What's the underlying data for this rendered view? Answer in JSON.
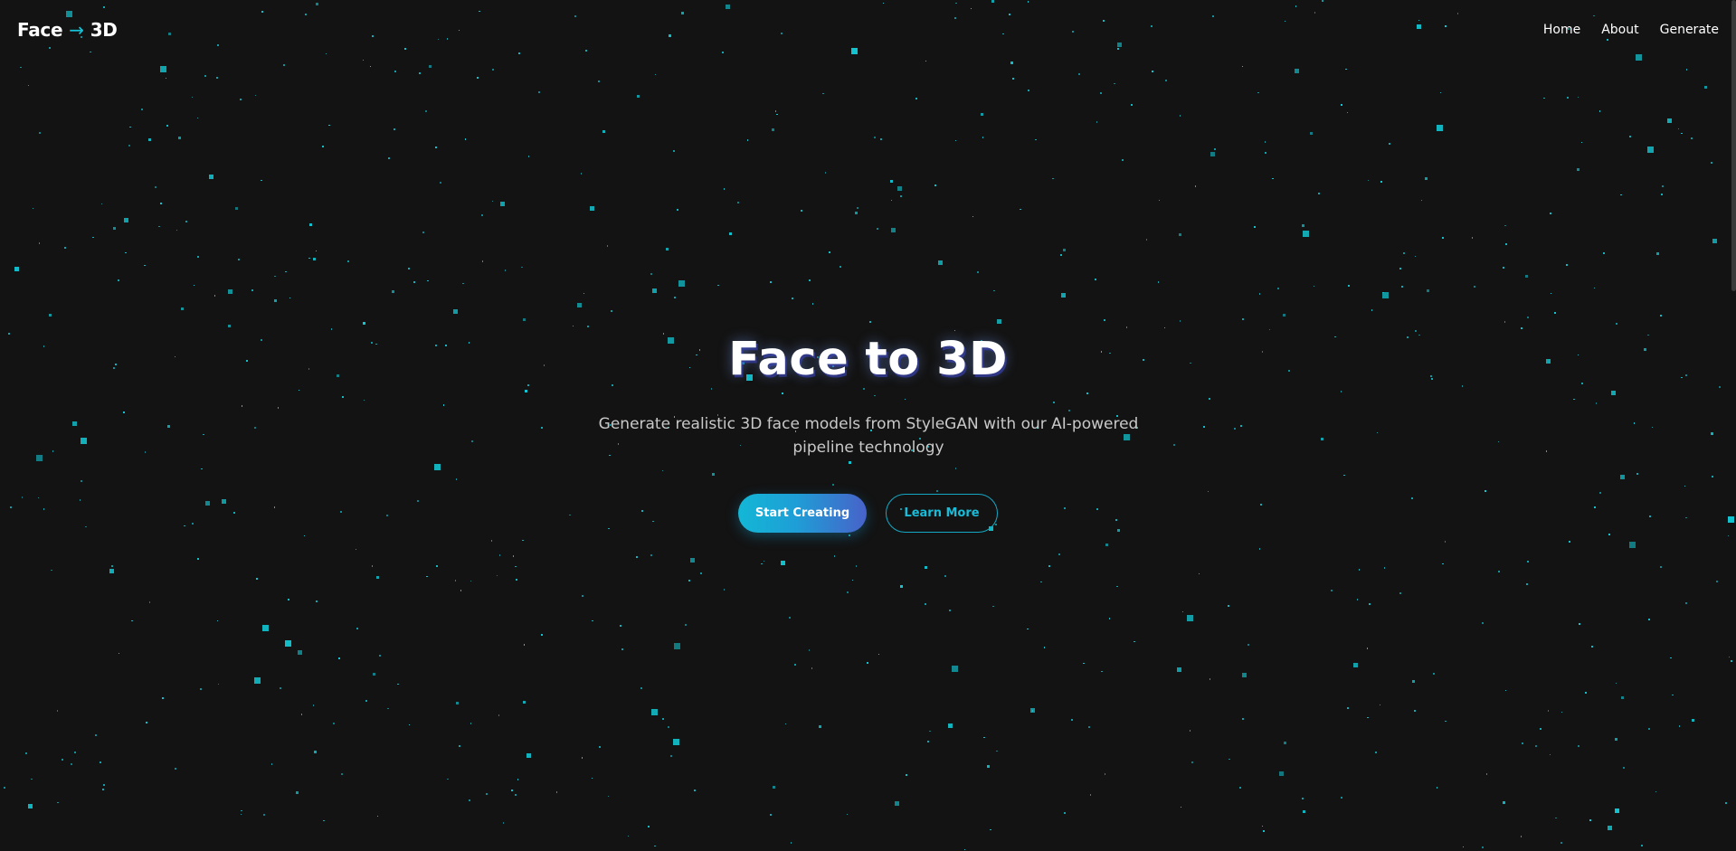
{
  "nav": {
    "logo_left": "Face",
    "logo_arrow": "→",
    "logo_right": "3D",
    "links": [
      "Home",
      "About",
      "Generate"
    ]
  },
  "hero": {
    "title": "Face to 3D",
    "subtitle_line1": "Generate realistic 3D face models from StyleGAN with our AI-powered",
    "subtitle_line2": "pipeline technology",
    "primary_button": "Start Creating",
    "secondary_button": "Learn More"
  },
  "colors": {
    "background": "#131313",
    "accent": "#12c6d2",
    "button_gradient_start": "#13b7d6",
    "button_gradient_end": "#4862c9"
  }
}
